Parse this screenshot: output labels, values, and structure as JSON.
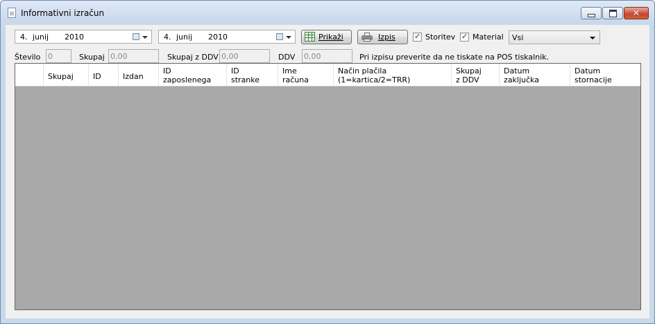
{
  "window": {
    "title": "Informativni izračun"
  },
  "filters": {
    "date_from": {
      "day": "4.",
      "month": "junij",
      "year": "2010"
    },
    "date_to": {
      "day": "4.",
      "month": "junij",
      "year": "2010"
    },
    "show_label": "Prikaži",
    "print_label": "Izpis",
    "services_label": "Storitev",
    "services_checked": true,
    "material_label": "Material",
    "material_checked": true,
    "type_selected": "Vsi"
  },
  "summary": {
    "count_label": "Število",
    "count_value": "0",
    "total_label": "Skupaj",
    "total_value": "0,00",
    "total_vat_label": "Skupaj z DDV",
    "total_vat_value": "0,00",
    "vat_label": "DDV",
    "vat_value": "0,00",
    "note": "Pri izpisu preverite da ne tiskate na POS tiskalnik."
  },
  "table": {
    "columns": [
      "Skupaj",
      "ID",
      "Izdan",
      "ID\nzaposlenega",
      "ID\nstranke",
      "Ime\nračuna",
      "Način plačila\n(1=kartica/2=TRR)",
      "Skupaj\nz DDV",
      "Datum\nzaključka",
      "Datum\nstornacije"
    ],
    "rows": []
  }
}
